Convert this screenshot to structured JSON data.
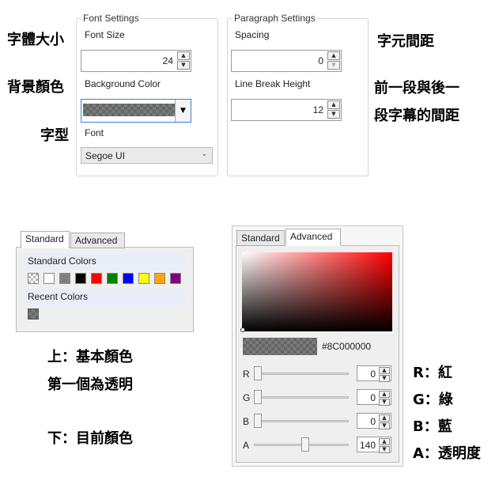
{
  "annotations": {
    "font_size": "字體大小",
    "background_color": "背景顏色",
    "font": "字型",
    "char_spacing": "字元間距",
    "line_break_1": "前一段與後一",
    "line_break_2": "段字幕的間距",
    "standard_1": "上：基本顏色",
    "standard_2": "第一個為透明",
    "recent": "下：目前顏色",
    "r": "R：紅",
    "g": "G：綠",
    "b": "B：藍",
    "a": "A：透明度"
  },
  "font_settings": {
    "legend": "Font Settings",
    "font_size_label": "Font Size",
    "font_size_value": "24",
    "background_color_label": "Background Color",
    "font_label": "Font",
    "font_value": "Segoe UI"
  },
  "paragraph_settings": {
    "legend": "Paragraph Settings",
    "spacing_label": "Spacing",
    "spacing_value": "0",
    "line_break_label": "Line Break Height",
    "line_break_value": "12"
  },
  "standard_panel": {
    "tabs": [
      "Standard",
      "Advanced"
    ],
    "standard_colors_label": "Standard Colors",
    "standard_colors": [
      "transparent",
      "#ffffff",
      "#808080",
      "#000000",
      "#ff0000",
      "#008000",
      "#0000ff",
      "#ffff00",
      "#ffa500",
      "#800080"
    ],
    "recent_colors_label": "Recent Colors"
  },
  "advanced_panel": {
    "tabs": [
      "Standard",
      "Advanced"
    ],
    "hex_value": "#8C000000",
    "gradient_hue": "#ff0000",
    "channels": [
      {
        "label": "R",
        "value": "0",
        "fraction": 0.0
      },
      {
        "label": "G",
        "value": "0",
        "fraction": 0.0
      },
      {
        "label": "B",
        "value": "0",
        "fraction": 0.0
      },
      {
        "label": "A",
        "value": "140",
        "fraction": 0.549
      }
    ]
  }
}
